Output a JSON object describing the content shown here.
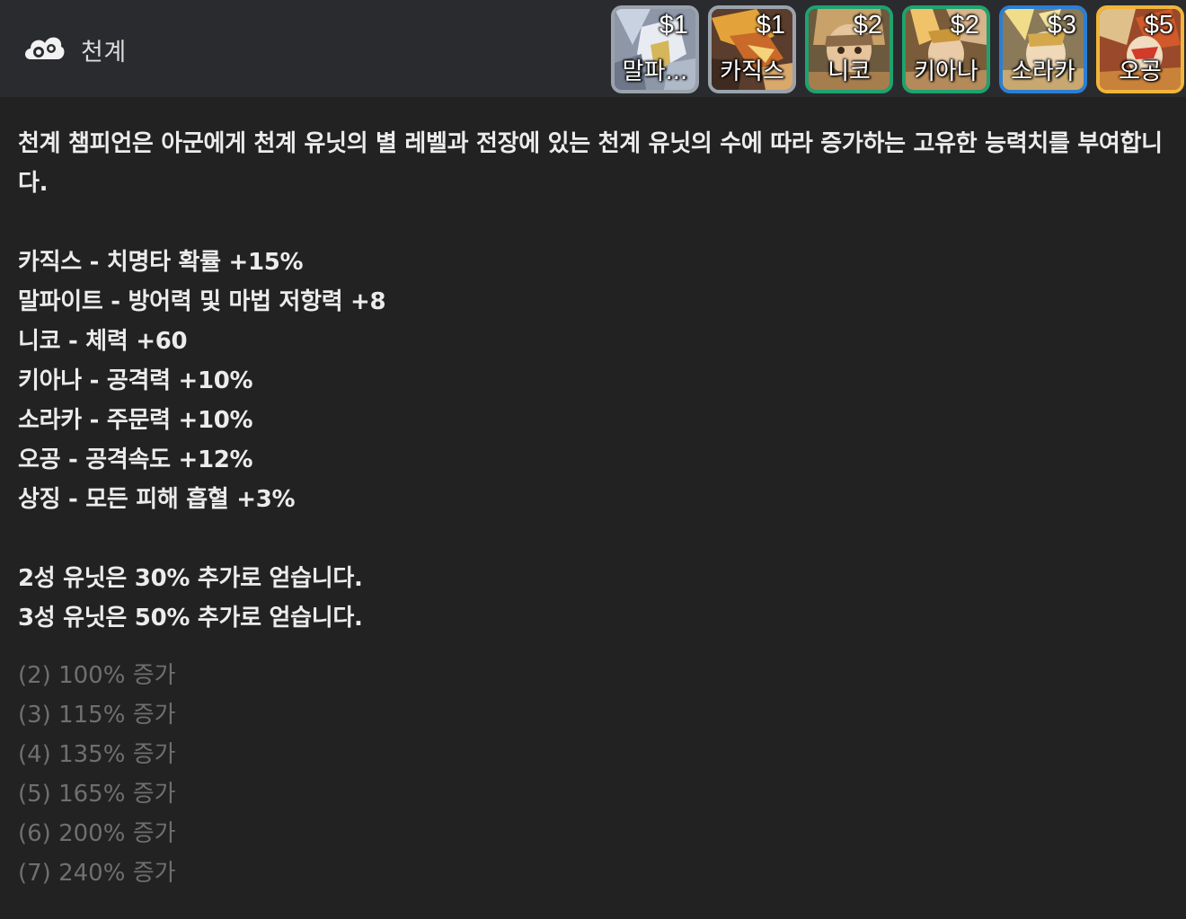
{
  "header": {
    "trait_icon": "cloud-swirl-icon",
    "trait_name": "천계"
  },
  "champions": [
    {
      "name": "말파...",
      "cost": "$1",
      "tier_color": "#9aa3ad",
      "portrait": "malphite-portrait"
    },
    {
      "name": "카직스",
      "cost": "$1",
      "tier_color": "#9aa3ad",
      "portrait": "khazix-portrait"
    },
    {
      "name": "니코",
      "cost": "$2",
      "tier_color": "#1fa26f",
      "portrait": "neeko-portrait"
    },
    {
      "name": "키아나",
      "cost": "$2",
      "tier_color": "#1fa26f",
      "portrait": "qiyana-portrait"
    },
    {
      "name": "소라카",
      "cost": "$3",
      "tier_color": "#2b7fd3",
      "portrait": "soraka-portrait"
    },
    {
      "name": "오공",
      "cost": "$5",
      "tier_color": "#f0b53b",
      "portrait": "wukong-portrait"
    }
  ],
  "description": "천계 챔피언은 아군에게 천계 유닛의 별 레벨과 전장에 있는 천계 유닛의 수에 따라 증가하는 고유한 능력치를 부여합니다.",
  "bonuses": [
    "카직스 - 치명타 확률 +15%",
    "말파이트 - 방어력 및 마법 저항력 +8",
    "니코 - 체력 +60",
    "키아나 - 공격력 +10%",
    "소라카 - 주문력 +10%",
    "오공 - 공격속도 +12%",
    "상징 - 모든 피해 흡혈 +3%"
  ],
  "star_bonuses": [
    "2성 유닛은 30% 추가로 얻습니다.",
    "3성 유닛은 50% 추가로 얻습니다."
  ],
  "tiers": [
    "(2) 100% 증가",
    "(3) 115% 증가",
    "(4) 135% 증가",
    "(5) 165% 증가",
    "(6) 200% 증가",
    "(7) 240% 증가"
  ]
}
